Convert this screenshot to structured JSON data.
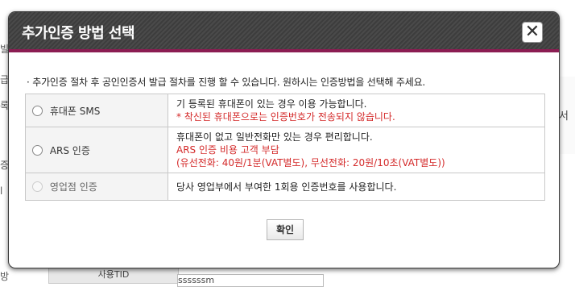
{
  "background": {
    "left_fragments": [
      "빌",
      "급",
      "록",
      "증",
      "l",
      "방"
    ],
    "right_fragment": "증서",
    "tab_label": "사용TID",
    "field_value": "ssssssm"
  },
  "modal": {
    "title": "추가인증 방법 선택",
    "close_icon": "close-icon",
    "intro": "· 추가인증 절차 후 공인인증서 발급 절차를 진행 할 수 있습니다. 원하시는 인증방법을 선택해 주세요.",
    "methods": [
      {
        "label": "휴대폰 SMS",
        "lines": [
          "기 등록된 휴대폰이 있는 경우 이용 가능합니다."
        ],
        "red_lines": [
          "* 착신된 휴대폰으로는 인증번호가 전송되지 않습니다."
        ],
        "disabled": false
      },
      {
        "label": "ARS 인증",
        "lines": [
          "휴대폰이 없고 일반전화만 있는 경우 편리합니다."
        ],
        "red_lines": [
          "ARS 인증 비용 고객 부담",
          "(유선전화: 40원/1분(VAT별도), 무선전화: 20원/10초(VAT별도))"
        ],
        "disabled": false
      },
      {
        "label": "영업점 인증",
        "lines": [
          "당사 영업부에서 부여한 1회용 인증번호를 사용합니다."
        ],
        "red_lines": [],
        "disabled": true
      }
    ],
    "confirm_label": "확인"
  },
  "colors": {
    "header_bg": "#444444",
    "header_underline": "#8b1d52",
    "warning_text": "#d42a2a"
  }
}
